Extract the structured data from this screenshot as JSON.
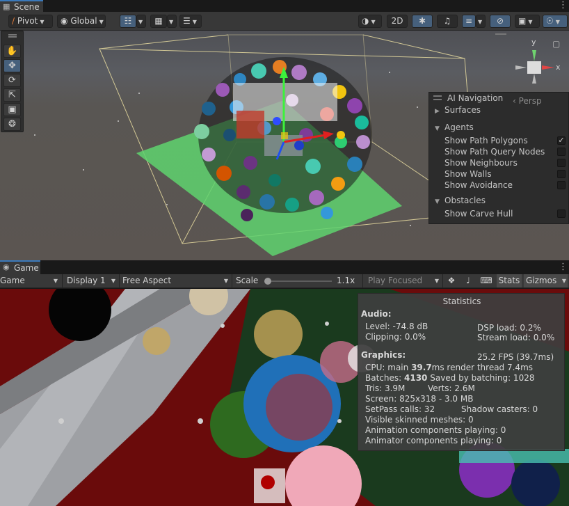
{
  "scene_tab": {
    "label": "Scene"
  },
  "scene_toolbar": {
    "pivot": "Pivot",
    "global": "Global",
    "mode_2d": "2D"
  },
  "ai_navigation": {
    "title": "AI Navigation",
    "persp": "‹ Persp",
    "sections": {
      "surfaces": "Surfaces",
      "agents": "Agents",
      "obstacles": "Obstacles"
    },
    "agent_options": [
      {
        "label": "Show Path Polygons",
        "checked": true
      },
      {
        "label": "Show Path Query Nodes",
        "checked": false
      },
      {
        "label": "Show Neighbours",
        "checked": false
      },
      {
        "label": "Show Walls",
        "checked": false
      },
      {
        "label": "Show Avoidance",
        "checked": false
      }
    ],
    "obstacle_options": [
      {
        "label": "Show Carve Hull",
        "checked": false
      }
    ]
  },
  "gizmo": {
    "x": "x",
    "y": "y"
  },
  "game_tab": {
    "label": "Game"
  },
  "game_toolbar": {
    "view": "Game",
    "display": "Display 1",
    "aspect": "Free Aspect",
    "scale_label": "Scale",
    "scale_value": "1.1x",
    "play_mode": "Play Focused",
    "stats": "Stats",
    "gizmos": "Gizmos"
  },
  "statistics": {
    "title": "Statistics",
    "audio_heading": "Audio:",
    "level": "Level: -74.8 dB",
    "dsp_load": "DSP load: 0.2%",
    "clipping": "Clipping: 0.0%",
    "stream_load": "Stream load: 0.0%",
    "graphics_heading": "Graphics:",
    "fps": "25.2 FPS (39.7ms)",
    "cpu_prefix": "CPU: main ",
    "cpu_main": "39.7",
    "cpu_suffix": "ms  render thread 7.4ms",
    "batches_prefix": "Batches: ",
    "batches": "4130",
    "batches_suffix": "  Saved by batching: 1028",
    "tris": "Tris: 3.9M",
    "verts": "Verts: 2.6M",
    "screen": "Screen: 825x318 - 3.0 MB",
    "setpass": "SetPass calls: 32",
    "shadow_casters": "Shadow casters: 0",
    "skinned": "Visible skinned meshes: 0",
    "animation": "Animation components playing: 0",
    "animator": "Animator components playing: 0"
  },
  "colors": {
    "accent": "#46607c",
    "navmesh": "#5fd46e",
    "game_background": "#6a0b0b"
  }
}
